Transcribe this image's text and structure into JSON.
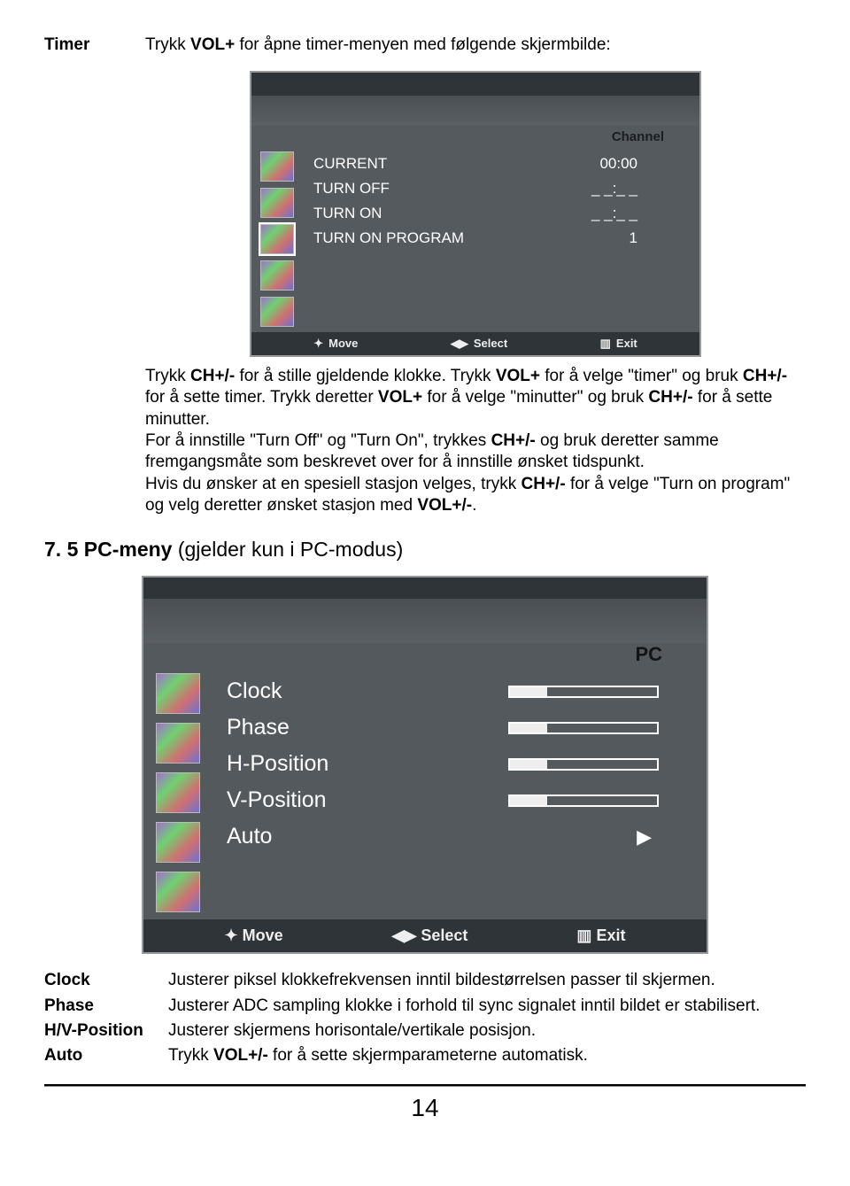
{
  "timer": {
    "label": "Timer",
    "intro_pre": "Trykk ",
    "intro_bold": "VOL+",
    "intro_post": " for åpne timer-menyen med følgende skjermbilde:"
  },
  "osd1": {
    "header": "Channel",
    "rows": [
      {
        "label": "CURRENT",
        "value": "00:00"
      },
      {
        "label": "TURN OFF",
        "value": "_ _:_ _"
      },
      {
        "label": "TURN ON",
        "value": "_ _:_ _"
      },
      {
        "label": "TURN ON PROGRAM",
        "value": "1"
      }
    ],
    "footer": {
      "move": "Move",
      "select": "Select",
      "exit": "Exit"
    }
  },
  "timer_para": "Trykk CH+/- for å stille gjeldende klokke. Trykk VOL+ for å velge \"timer\" og bruk CH+/- for å sette timer. Trykk deretter VOL+ for å velge \"minutter\" og bruk CH+/- for å sette minutter. For å innstille \"Turn Off\" og \"Turn On\", trykkes CH+/- og bruk deretter samme fremgangsmåte som beskrevet over for å innstille ønsket tidspunkt. Hvis du ønsker at en spesiell stasjon velges, trykk CH+/- for å velge \"Turn on program\" og velg deretter ønsket stasjon med VOL+/-.",
  "sec75": {
    "num": "7. 5 ",
    "title_bold": "PC-meny ",
    "title_light": "(gjelder kun i PC-modus)"
  },
  "osd2": {
    "header": "PC",
    "rows": [
      {
        "label": "Clock",
        "type": "bar"
      },
      {
        "label": "Phase",
        "type": "bar"
      },
      {
        "label": "H-Position",
        "type": "bar"
      },
      {
        "label": "V-Position",
        "type": "bar"
      },
      {
        "label": "Auto",
        "type": "arrow"
      }
    ],
    "footer": {
      "move": "Move",
      "select": "Select",
      "exit": "Exit"
    }
  },
  "defs": [
    {
      "term": "Clock",
      "text": "Justerer piksel klokkefrekvensen inntil bildestørrelsen passer til skjermen."
    },
    {
      "term": "Phase",
      "text": "Justerer ADC sampling klokke i forhold til sync signalet inntil bildet er stabilisert."
    },
    {
      "term": "H/V-Position",
      "text": "Justerer skjermens horisontale/vertikale posisjon."
    },
    {
      "term": "Auto",
      "text_pre": "Trykk ",
      "bold": "VOL+/-",
      "text_post": " for å sette skjermparameterne automatisk."
    }
  ],
  "page_number": "14",
  "chart_data": {
    "type": "table",
    "title": "Timer OSD values",
    "categories": [
      "CURRENT",
      "TURN OFF",
      "TURN ON",
      "TURN ON PROGRAM"
    ],
    "values": [
      "00:00",
      "_ _:_ _",
      "_ _:_ _",
      "1"
    ]
  }
}
